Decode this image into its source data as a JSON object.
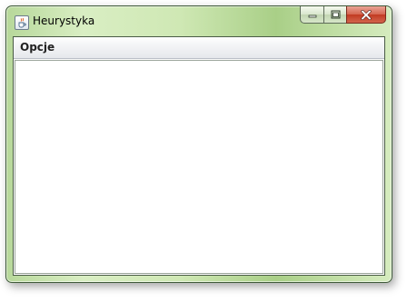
{
  "window": {
    "title": "Heurystyka",
    "app_icon": "java-cup-icon",
    "controls": [
      "minimize-icon",
      "maximize-icon",
      "close-icon"
    ]
  },
  "menubar": {
    "items": [
      {
        "label": "Opcje"
      }
    ]
  },
  "colors": {
    "frame_accent": "#b7d89a",
    "close_button": "#c23a22",
    "content_background": "#ffffff"
  }
}
